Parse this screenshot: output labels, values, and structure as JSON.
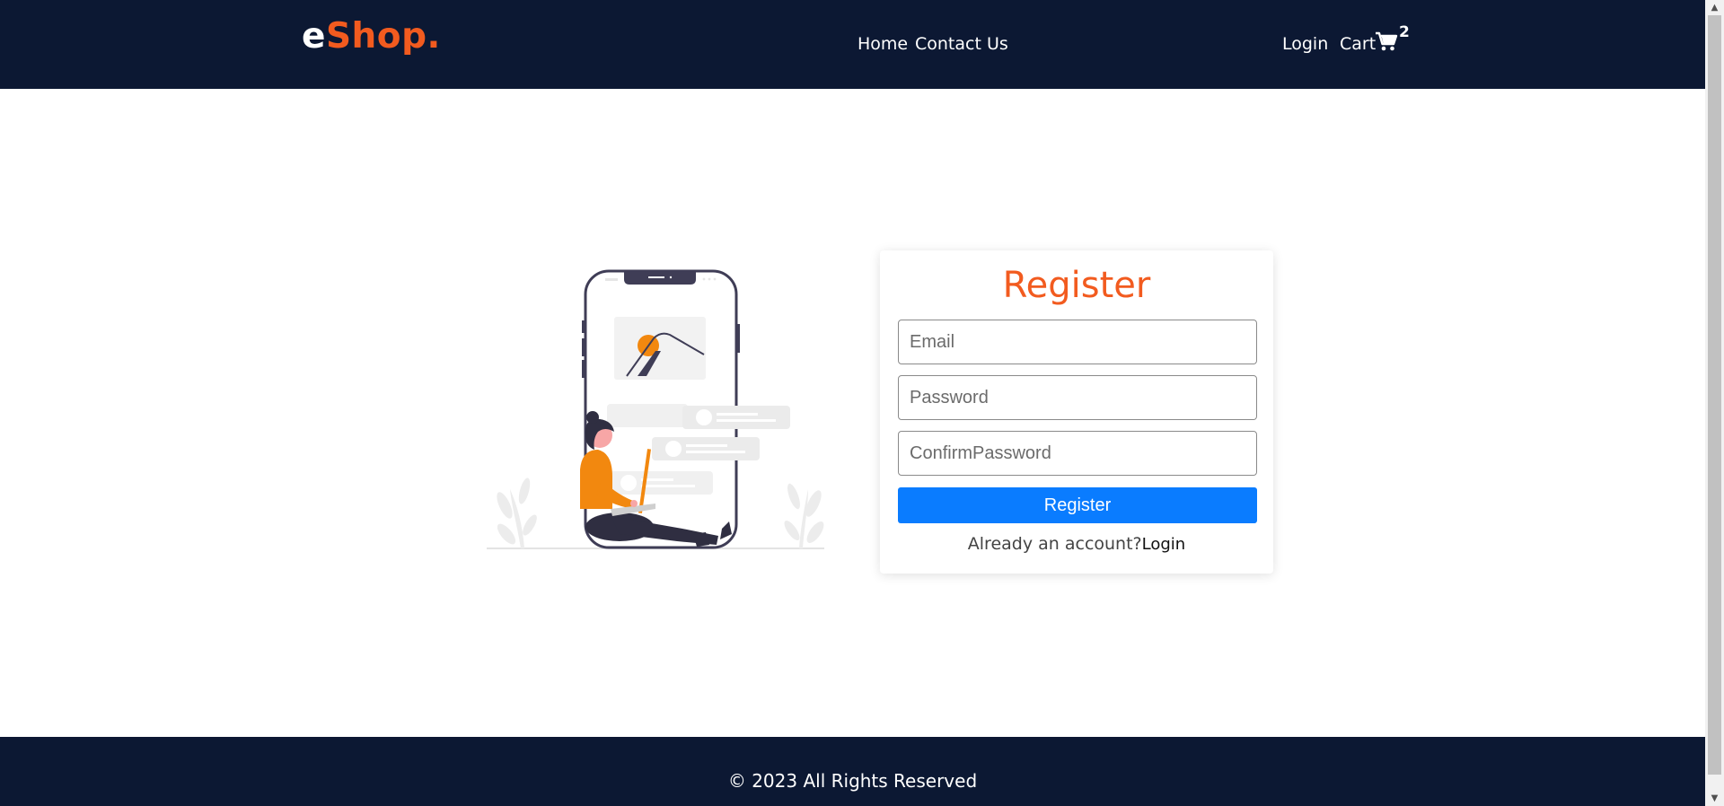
{
  "header": {
    "logo_prefix": "e",
    "logo_accent": "Shop",
    "logo_suffix": ".",
    "nav": {
      "home": "Home",
      "contact": "Contact Us"
    },
    "login": "Login",
    "cart_label": "Cart",
    "cart_count": "2",
    "cart_icon": "shopping-cart-icon"
  },
  "register": {
    "title": "Register",
    "email_placeholder": "Email",
    "password_placeholder": "Password",
    "confirm_placeholder": "ConfirmPassword",
    "submit_label": "Register",
    "signin_prompt": "Already an account?",
    "signin_link": "Login"
  },
  "footer": {
    "text": "© 2023 All Rights Reserved"
  },
  "colors": {
    "header_bg": "#0c1833",
    "accent": "#f25b1f",
    "button": "#0a7cff"
  }
}
